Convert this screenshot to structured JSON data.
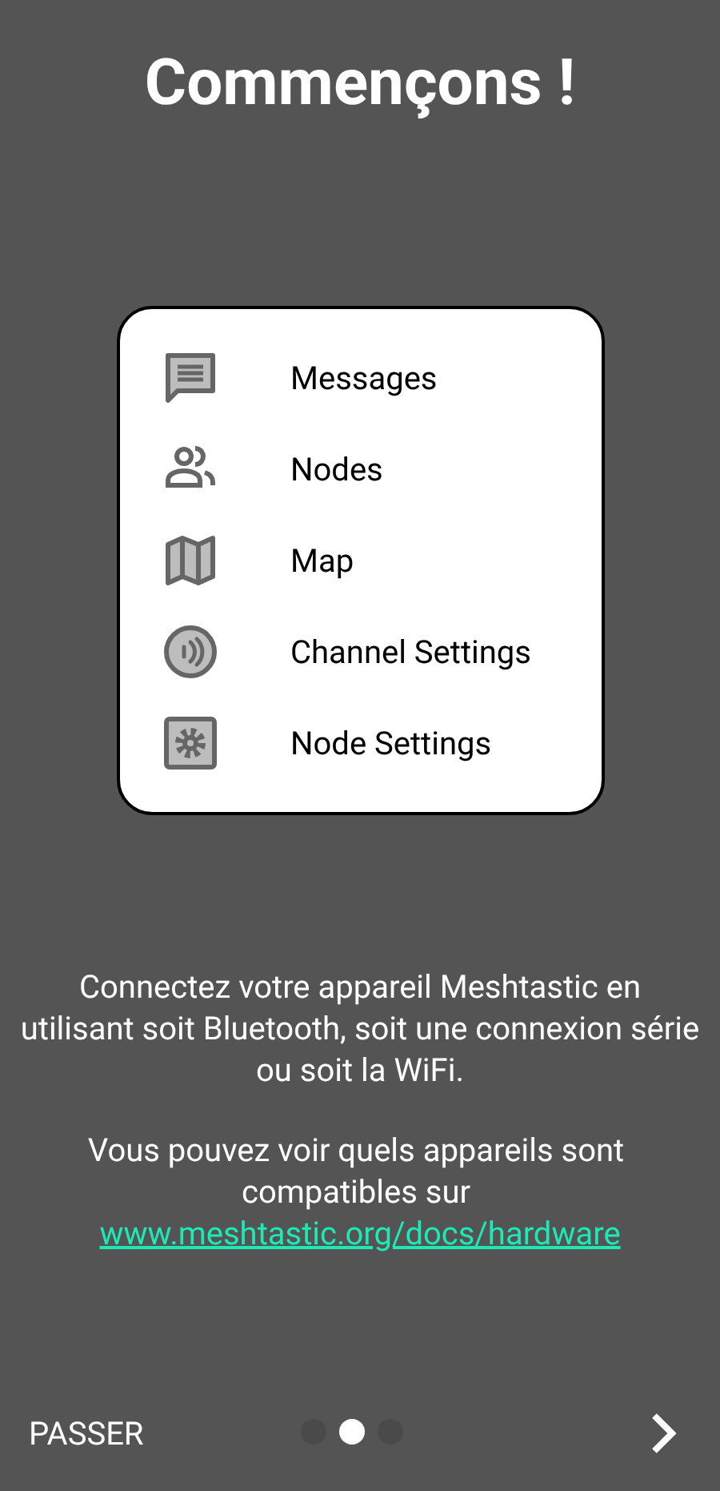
{
  "title": "Commençons !",
  "features": [
    {
      "kind": "messages",
      "label": "Messages"
    },
    {
      "kind": "nodes",
      "label": "Nodes"
    },
    {
      "kind": "map",
      "label": "Map"
    },
    {
      "kind": "channel",
      "label": "Channel Settings"
    },
    {
      "kind": "node_settings",
      "label": "Node Settings"
    }
  ],
  "intro": "Connectez votre appareil Meshtastic en utilisant soit Bluetooth, soit une connexion série ou soit la WiFi.",
  "compat": {
    "text": "Vous pouvez voir quels appareils sont compatibles sur",
    "link_lines": [
      "www.meshtastic.org/docs/",
      "hardware"
    ]
  },
  "footer": {
    "skip": "PASSER",
    "pages": [
      {
        "selected": false
      },
      {
        "selected": true
      },
      {
        "selected": false
      }
    ]
  }
}
